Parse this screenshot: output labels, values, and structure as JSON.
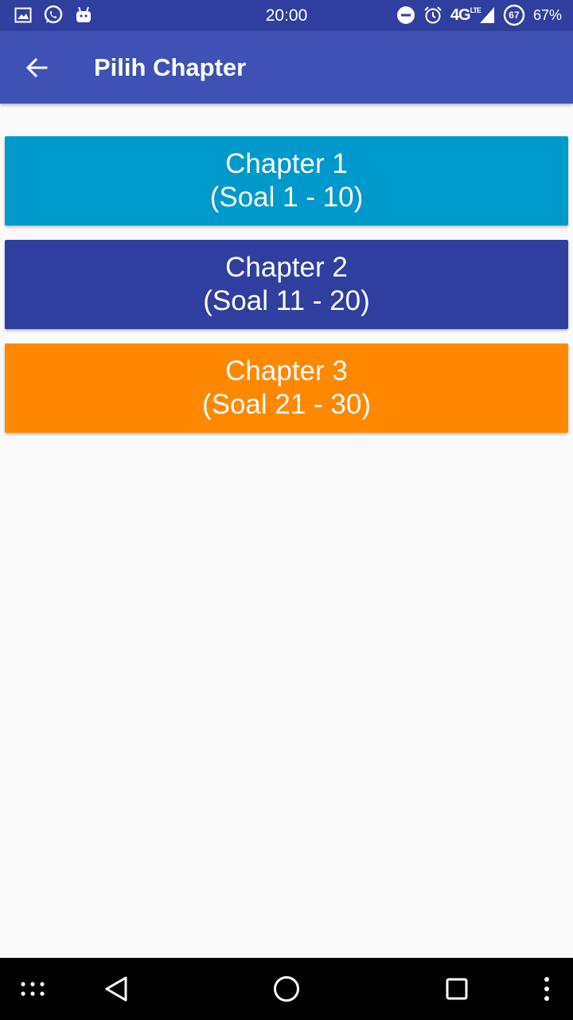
{
  "status_bar": {
    "time": "20:00",
    "network": "4G",
    "network_sup": "LTE",
    "battery_badge": "67",
    "battery_percent": "67%",
    "icons": [
      "gallery-icon",
      "whatsapp-icon",
      "android-icon",
      "do-not-disturb-icon",
      "alarm-icon",
      "signal-icon",
      "battery-icon"
    ]
  },
  "app_bar": {
    "title": "Pilih Chapter",
    "back_icon": "arrow-back-icon",
    "color": "#3F51B5"
  },
  "chapters": [
    {
      "title": "Chapter 1",
      "range": "(Soal 1 - 10)",
      "color": "#0099CC"
    },
    {
      "title": "Chapter 2",
      "range": "(Soal 11 - 20)",
      "color": "#303F9F"
    },
    {
      "title": "Chapter 3",
      "range": "(Soal 21 - 30)",
      "color": "#FF8800"
    }
  ],
  "nav_bar": {
    "icons": [
      "app-grid-icon",
      "back-triangle-icon",
      "home-circle-icon",
      "recents-square-icon",
      "more-vert-icon"
    ]
  }
}
